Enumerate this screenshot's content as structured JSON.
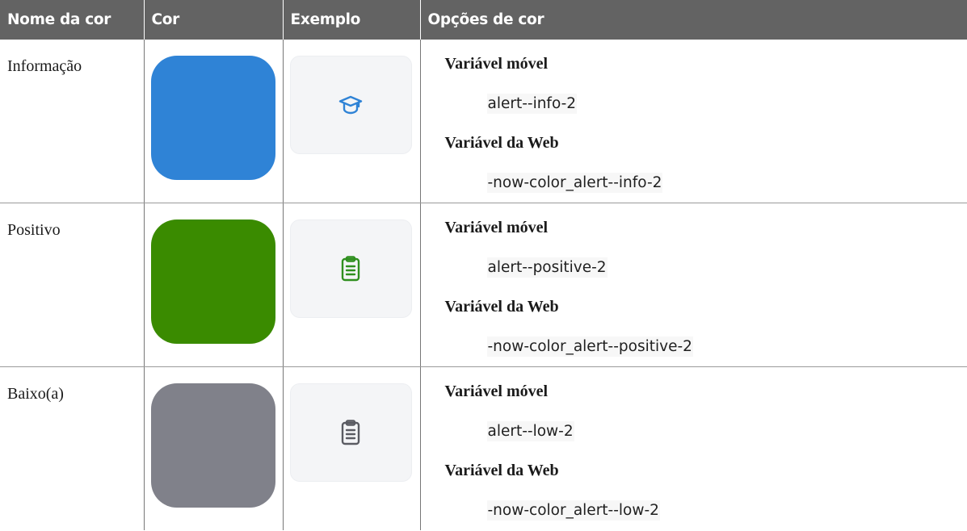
{
  "headers": [
    "Nome da cor",
    "Cor",
    "Exemplo",
    "Opções de cor"
  ],
  "rows": [
    {
      "name": "Informação",
      "swatch_color": "#2f83d6",
      "icon": "graduation-cap-icon",
      "icon_color": "#2f83d6",
      "mobile_label": "Variável móvel",
      "mobile_value": "alert--info-2",
      "web_label": "Variável da Web",
      "web_value": "-now-color_alert--info-2"
    },
    {
      "name": "Positivo",
      "swatch_color": "#3a8b00",
      "icon": "clipboard-icon",
      "icon_color": "#2f8f1f",
      "mobile_label": "Variável móvel",
      "mobile_value": "alert--positive-2",
      "web_label": "Variável da Web",
      "web_value": "-now-color_alert--positive-2"
    },
    {
      "name": "Baixo(a)",
      "swatch_color": "#80818a",
      "icon": "clipboard-icon",
      "icon_color": "#5a5b62",
      "mobile_label": "Variável móvel",
      "mobile_value": "alert--low-2",
      "web_label": "Variável da Web",
      "web_value": "-now-color_alert--low-2"
    }
  ]
}
